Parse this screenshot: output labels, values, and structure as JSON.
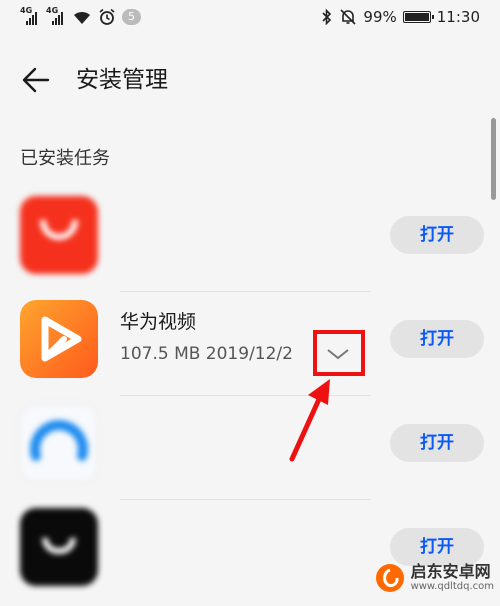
{
  "status_bar": {
    "signal1_tag": "4G",
    "signal2_tag": "4G",
    "notification_count": "5",
    "battery_percent": "99%",
    "battery_level": 0.99,
    "time": "11:30"
  },
  "header": {
    "title": "安装管理"
  },
  "section": {
    "title": "已安装任务"
  },
  "apps": [
    {
      "name": "",
      "meta": "",
      "button": "打开"
    },
    {
      "name": "华为视频",
      "meta": "107.5 MB  2019/12/2",
      "button": "打开"
    },
    {
      "name": "",
      "meta": "",
      "button": "打开"
    },
    {
      "name": "",
      "meta": "",
      "button": "打开"
    }
  ],
  "colors": {
    "accent": "#0a59f7",
    "highlight": "#e11111"
  },
  "watermark": {
    "line1": "启东安卓网",
    "line2": "www.qdltdq.com"
  }
}
